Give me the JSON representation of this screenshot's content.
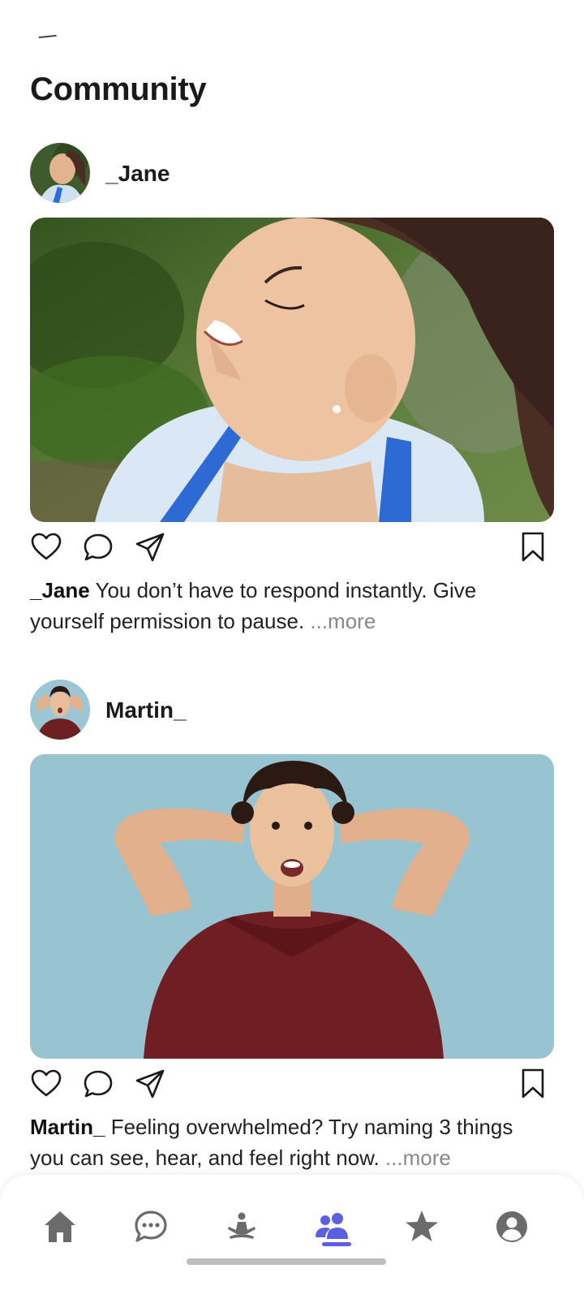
{
  "header": {
    "title": "Community"
  },
  "posts": [
    {
      "username": "_Jane",
      "caption_user": "_Jane",
      "caption_text": " You don’t have to respond instantly. Give yourself permission to pause. ",
      "more_label": "...more"
    },
    {
      "username": "Martin_",
      "caption_user": "Martin_",
      "caption_text": " Feeling overwhelmed? Try naming 3 things you can see, hear, and feel right now. ",
      "more_label": "...more"
    }
  ],
  "post_actions": [
    "heart-icon",
    "comment-icon",
    "send-icon",
    "bookmark-icon"
  ],
  "nav": {
    "items": [
      {
        "name": "home",
        "icon": "home-icon",
        "active": false
      },
      {
        "name": "chat",
        "icon": "chat-bubble-icon",
        "active": false
      },
      {
        "name": "meditate",
        "icon": "meditation-icon",
        "active": false
      },
      {
        "name": "community",
        "icon": "community-icon",
        "active": true
      },
      {
        "name": "favorites",
        "icon": "star-icon",
        "active": false
      },
      {
        "name": "profile",
        "icon": "profile-icon",
        "active": false
      }
    ],
    "inactive_color": "#6b6b6b",
    "active_color": "#5b5fe3"
  }
}
